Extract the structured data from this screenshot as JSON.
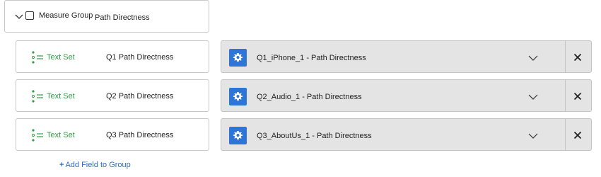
{
  "group": {
    "label": "Measure Group",
    "value": "Path Directness"
  },
  "rows": [
    {
      "type_label": "Text Set",
      "question": "Q1 Path Directness",
      "mapping": "Q1_iPhone_1 - Path Directness"
    },
    {
      "type_label": "Text Set",
      "question": "Q2 Path Directness",
      "mapping": "Q2_Audio_1 - Path Directness"
    },
    {
      "type_label": "Text Set",
      "question": "Q3 Path Directness",
      "mapping": "Q3_AboutUs_1 - Path Directness"
    }
  ],
  "add_field": {
    "plus": "+",
    "label": "Add Field to Group"
  },
  "colors": {
    "accent_blue": "#2d76d8",
    "text_set_green": "#2f9e44",
    "link_blue": "#2b6cc4"
  },
  "icons": [
    "chevron-down-icon",
    "checkbox-icon",
    "text-set-icon",
    "gear-icon",
    "close-icon",
    "plus-icon"
  ]
}
